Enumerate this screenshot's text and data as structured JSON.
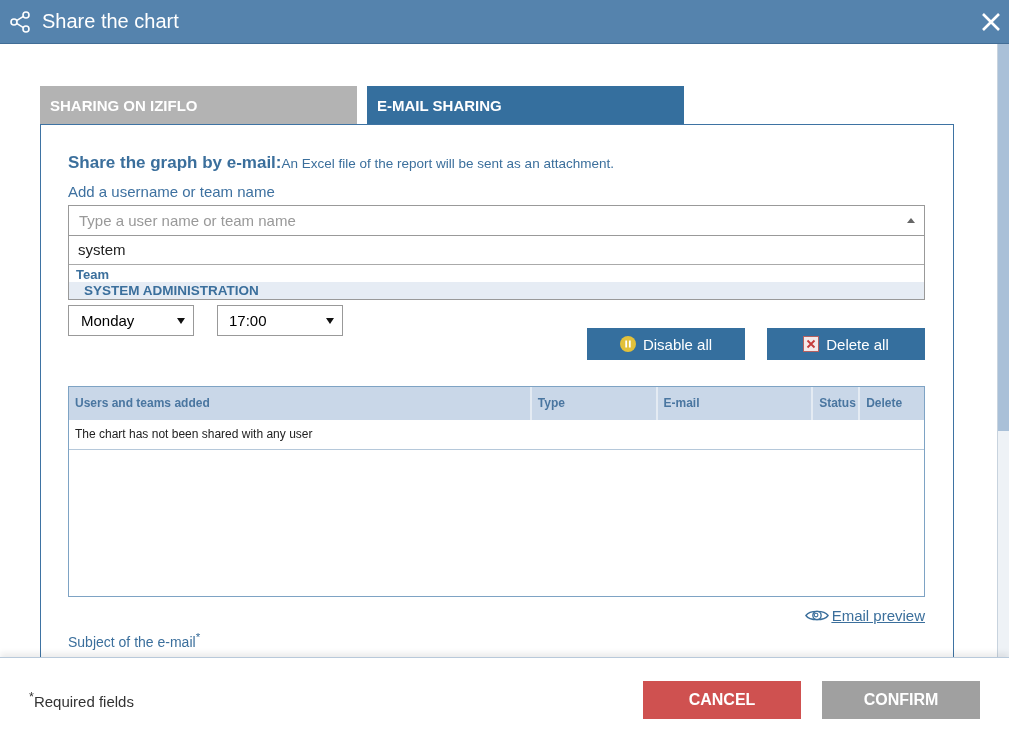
{
  "window": {
    "title": "Share the chart"
  },
  "tabs": [
    {
      "label": "SHARING ON IZIFLO",
      "selected": false
    },
    {
      "label": "E-MAIL SHARING",
      "selected": true
    }
  ],
  "heading": {
    "title": "Share the graph by e-mail:",
    "note": "An Excel file of the report will be sent as an attachment."
  },
  "recipient": {
    "label": "Add a username or team name",
    "placeholder": "Type a user name or team name",
    "search": "system",
    "results": [
      {
        "group": "Team",
        "items": [
          {
            "label": "SYSTEM ADMINISTRATION",
            "selected": true
          }
        ]
      }
    ]
  },
  "schedule": {
    "day": "Monday",
    "time": "17:00"
  },
  "buttons": [
    {
      "label": "Disable all",
      "kind": "disable"
    },
    {
      "label": "Delete all",
      "kind": "delete"
    }
  ],
  "table": {
    "columns": [
      "Users and teams added",
      "Type",
      "E-mail",
      "Status",
      "Delete"
    ],
    "empty": "The chart has not been shared with any user"
  },
  "preview_link": "Email preview",
  "subject_label": "Subject of the e-mail$^{*}$",
  "footer": {
    "note": "$^{*}$Required fields",
    "actions": [
      {
        "label": "CANCEL",
        "kind": "cancel"
      },
      {
        "label": "CONFIRM",
        "kind": "confirm"
      }
    ]
  }
}
